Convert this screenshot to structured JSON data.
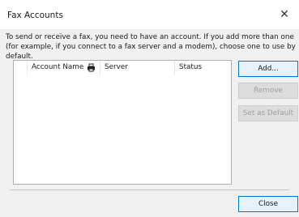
{
  "window": {
    "title": "Fax Accounts",
    "close_glyph": "✕"
  },
  "description": "To send or receive a fax, you need to have an account. If you add more than one (for example, if you connect to a fax server and a modem), choose one to use by default.",
  "accounts_list": {
    "columns": [
      "Account Name",
      "Server",
      "Status"
    ],
    "rows": []
  },
  "buttons": {
    "add": "Add...",
    "remove": "Remove",
    "set_default": "Set as Default",
    "close": "Close"
  }
}
